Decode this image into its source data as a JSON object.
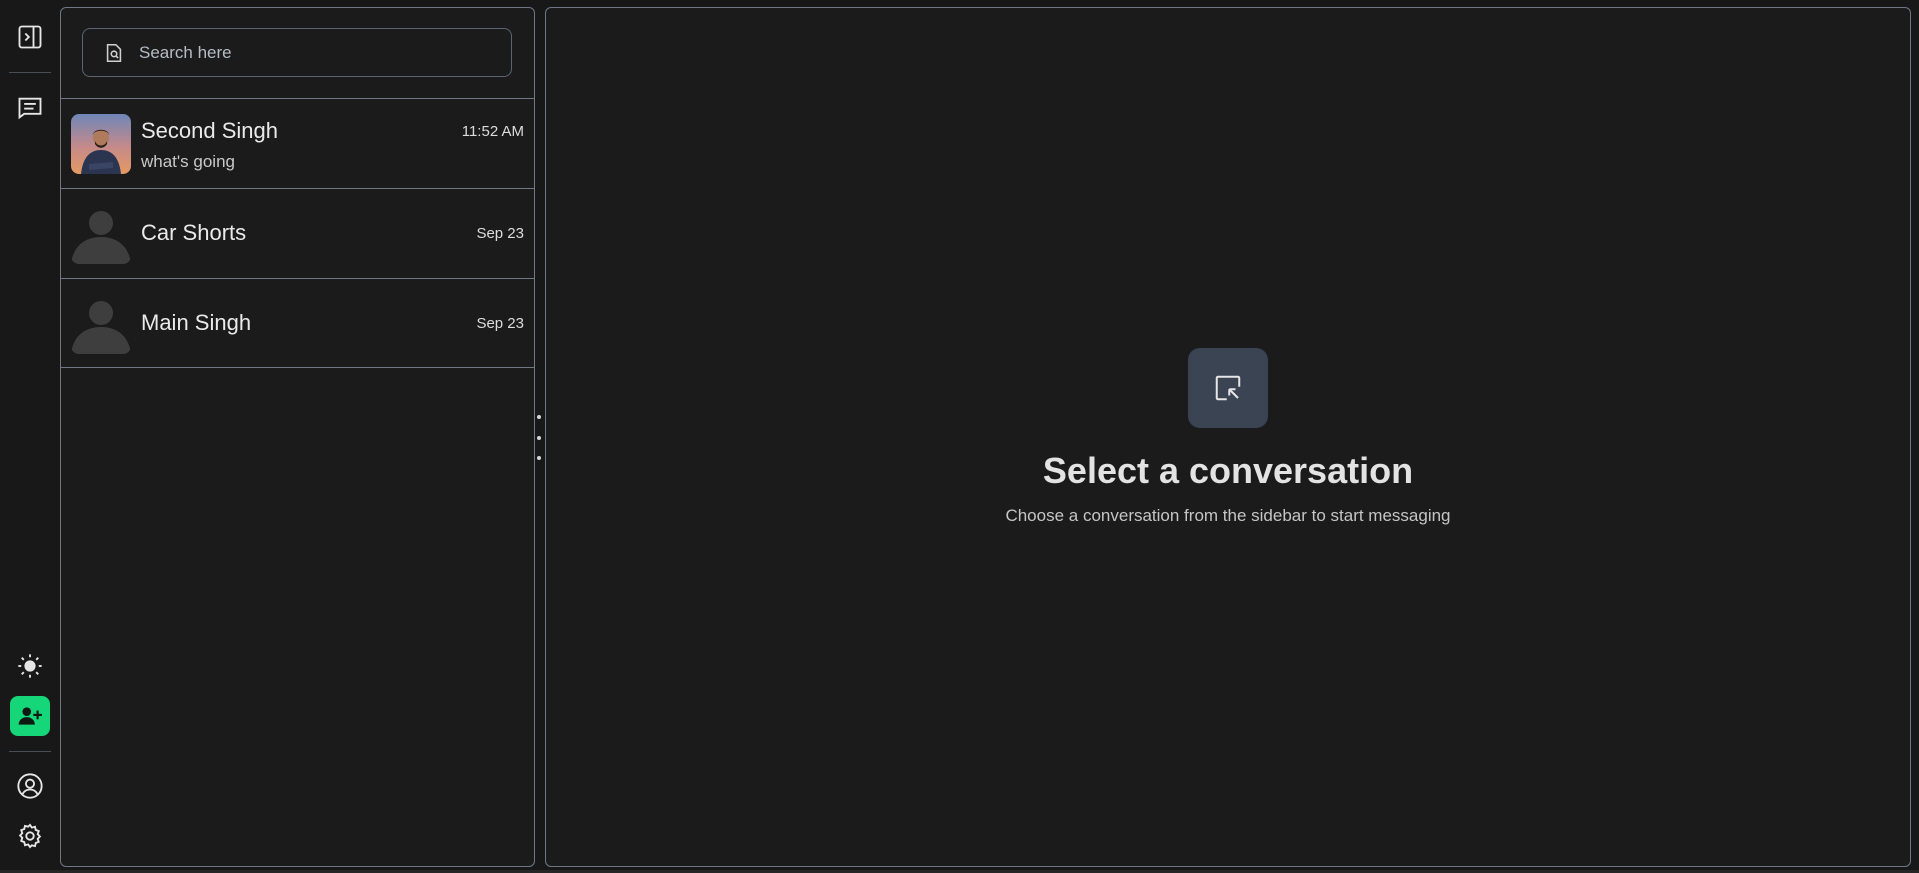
{
  "search": {
    "placeholder": "Search here"
  },
  "conversations": [
    {
      "name": "Second Singh",
      "preview": "what's going",
      "time": "11:52 AM",
      "avatar": "photo"
    },
    {
      "name": "Car Shorts",
      "preview": "",
      "time": "Sep 23",
      "avatar": "default"
    },
    {
      "name": "Main Singh",
      "preview": "",
      "time": "Sep 23",
      "avatar": "default"
    }
  ],
  "empty_state": {
    "title": "Select a conversation",
    "subtitle": "Choose a conversation from the sidebar to start messaging"
  },
  "colors": {
    "background": "#181818",
    "panel_border": "#6f7785",
    "accent_green": "#16d67a",
    "empty_icon_bg": "#3a4453"
  },
  "icons": {
    "rail": [
      "sidebar-toggle-icon",
      "chat-icon",
      "sun-icon",
      "add-user-icon",
      "profile-icon",
      "settings-icon"
    ],
    "search": "search-icon",
    "empty_state": "cursor-select-icon"
  }
}
